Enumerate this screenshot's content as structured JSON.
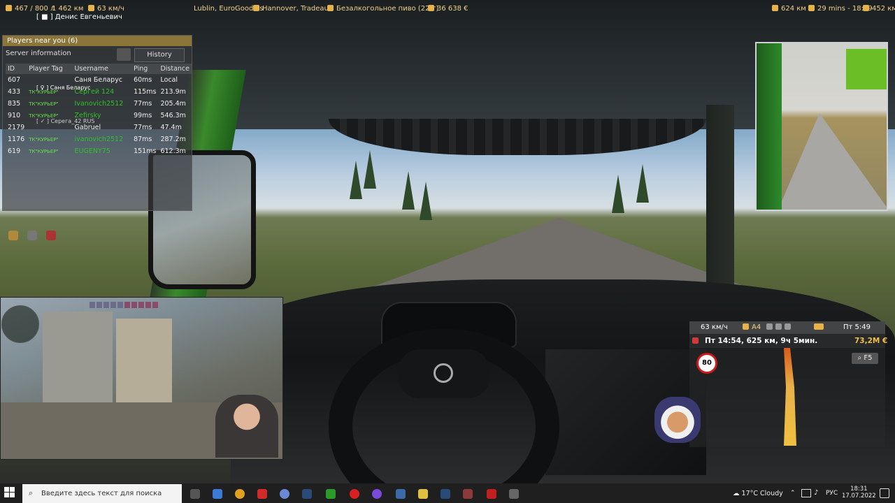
{
  "hud_top": {
    "distance": "467 / 800 л",
    "odometer": "1 462 км",
    "speed": "63 км/ч",
    "source": "Lublin, EuroGoodies",
    "destination": "Hannover, Tradeaux",
    "cargo": "Безалкогольное пиво (22 т)",
    "income": "36 638 €",
    "remaining_km": "624 км",
    "eta": "29 mins - 18:59",
    "fuel_range": "452 км"
  },
  "driver_name": "[ ■ ] Денис Евгеньевич",
  "players_panel": {
    "title": "Players near you (6)",
    "subtitle": "Server information",
    "history_label": "History",
    "columns": [
      "ID",
      "Player Tag",
      "Username",
      "Ping",
      "Distance"
    ],
    "rows": [
      {
        "id": "607",
        "tag": "",
        "username": "Саня Беларус",
        "ping": "60ms",
        "distance": "Local",
        "green": false
      },
      {
        "id": "433",
        "tag": "ТК\"КУРЬЕР\"",
        "username": "Сергей 124",
        "ping": "115ms",
        "distance": "213.9m",
        "green": true
      },
      {
        "id": "835",
        "tag": "ТК\"КУРЬЕР\"",
        "username": "Ivanovich2512",
        "ping": "77ms",
        "distance": "205.4m",
        "green": true
      },
      {
        "id": "910",
        "tag": "ТК\"КУРЬЕР\"",
        "username": "Zefirsky",
        "ping": "99ms",
        "distance": "546.3m",
        "green": true
      },
      {
        "id": "2179",
        "tag": "",
        "username": "Gabruel",
        "ping": "77ms",
        "distance": "47.4m",
        "green": false
      },
      {
        "id": "1176",
        "tag": "ТК\"КУРЬЕР\"",
        "username": "ivanovich2512",
        "ping": "87ms",
        "distance": "287.2m",
        "green": true
      },
      {
        "id": "619",
        "tag": "ТК\"КУРЬЕР\"",
        "username": "EUGENY75",
        "ping": "151ms",
        "distance": "612.3m",
        "green": true
      }
    ],
    "overlay_tags": [
      "[ ♀ ] Саня Беларус",
      "[ ✓ ] Серега_42 RUS"
    ]
  },
  "navigation": {
    "speed": "63 км/ч",
    "road": "A4",
    "time": "Пт 5:49",
    "arrival": "Пт 14:54, 625 км, 9ч 5мин.",
    "money": "73,2M €",
    "speed_limit": "80",
    "f5_label": "F5"
  },
  "taskbar": {
    "search_placeholder": "Введите здесь текст для поиска",
    "weather": "17°C  Cloudy",
    "language": "РУС",
    "time": "18:31",
    "date": "17.07.2022"
  },
  "colors": {
    "hud_text": "#f2d18a",
    "accent_green": "#2ec02a",
    "money_gold": "#f0c040",
    "speed_limit_red": "#d01818"
  }
}
